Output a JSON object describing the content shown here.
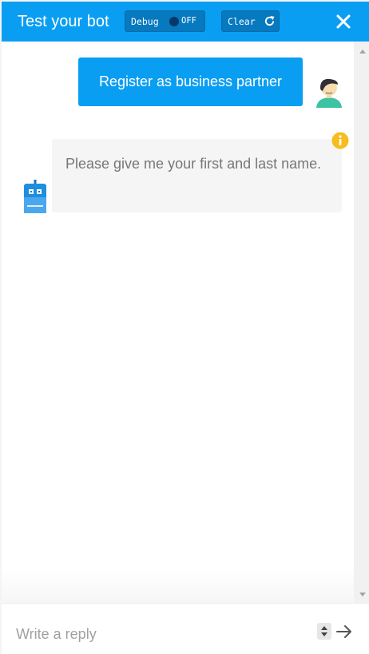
{
  "header": {
    "title": "Test your bot",
    "debug": {
      "label": "Debug",
      "state": "OFF"
    },
    "clear": {
      "label": "Clear"
    },
    "close_icon": "close-icon",
    "background": "#0a9ef2"
  },
  "messages": [
    {
      "sender": "user",
      "text": "Register as business partner",
      "avatar_icon": "user-avatar-icon"
    },
    {
      "sender": "bot",
      "text": "Please give me your first and last name.",
      "avatar_icon": "bot-avatar-icon",
      "badge_icon": "info-icon"
    }
  ],
  "composer": {
    "placeholder": "Write a reply",
    "value": "",
    "send_icon": "arrow-right-icon"
  },
  "colors": {
    "accent": "#0a9ef2",
    "bot_bubble": "#f5f5f5",
    "info_badge": "#f7bd1d"
  }
}
